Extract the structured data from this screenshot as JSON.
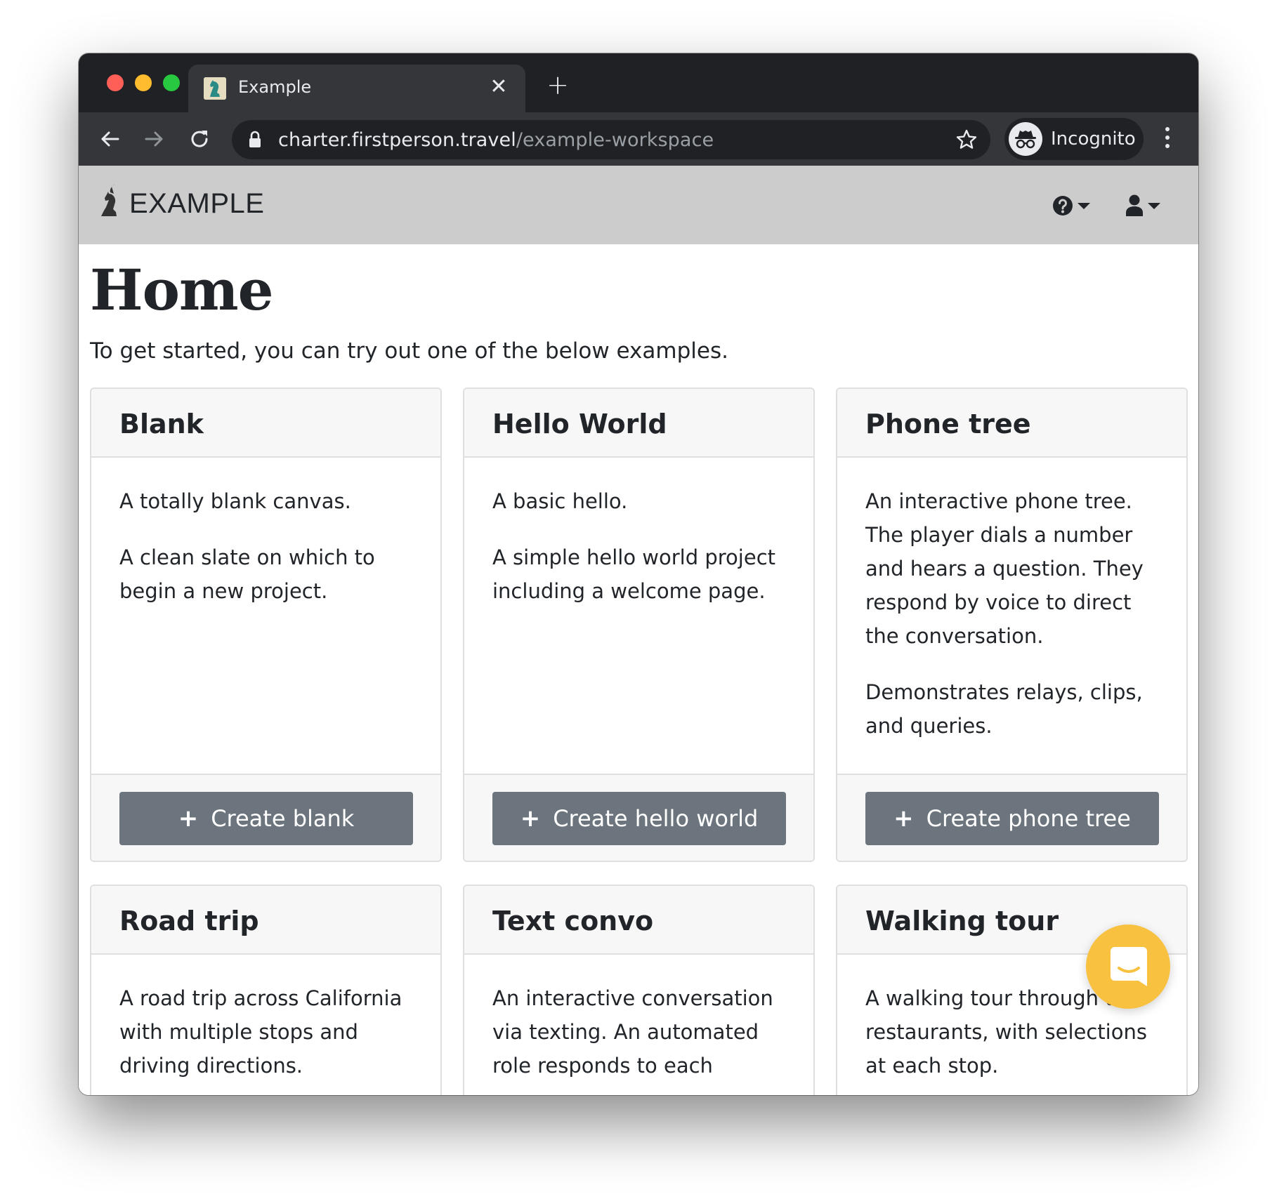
{
  "browser": {
    "tab_title": "Example",
    "tab_close": "✕",
    "new_tab": "+",
    "url_host": "charter.firstperson.travel",
    "url_path": "/example-workspace",
    "incognito_label": "Incognito"
  },
  "app": {
    "brand": "EXAMPLE",
    "page_title": "Home",
    "intro": "To get started, you can try out one of the below examples."
  },
  "cards": [
    {
      "title": "Blank",
      "paragraphs": [
        "A totally blank canvas.",
        "A clean slate on which to begin a new project."
      ],
      "button": "Create blank"
    },
    {
      "title": "Hello World",
      "paragraphs": [
        "A basic hello.",
        "A simple hello world project including a welcome page."
      ],
      "button": "Create hello world"
    },
    {
      "title": "Phone tree",
      "paragraphs": [
        "An interactive phone tree. The player dials a number and hears a question. They respond by voice to direct the conversation.",
        "Demonstrates relays, clips, and queries."
      ],
      "button": "Create phone tree"
    },
    {
      "title": "Road trip",
      "paragraphs": [
        "A road trip across California with multiple stops and driving directions."
      ]
    },
    {
      "title": "Text convo",
      "paragraphs": [
        "An interactive conversation via texting. An automated role responds to each"
      ]
    },
    {
      "title": "Walking tour",
      "paragraphs": [
        "A walking tour through two restaurants, with selections at each stop."
      ]
    }
  ],
  "icons": {
    "favicon": "chess-knight-icon",
    "back": "arrow-left-icon",
    "forward": "arrow-right-icon",
    "reload": "reload-icon",
    "lock": "lock-icon",
    "star": "star-icon",
    "incognito": "incognito-icon",
    "menu": "vertical-dots-icon",
    "help": "question-circle-icon",
    "user": "user-icon",
    "plus": "plus-icon",
    "chat": "chat-icon"
  },
  "colors": {
    "chrome_dark": "#202124",
    "chrome_tab": "#35363a",
    "app_nav": "#cccccc",
    "button": "#6c757d",
    "chat_launcher": "#f9c140"
  }
}
